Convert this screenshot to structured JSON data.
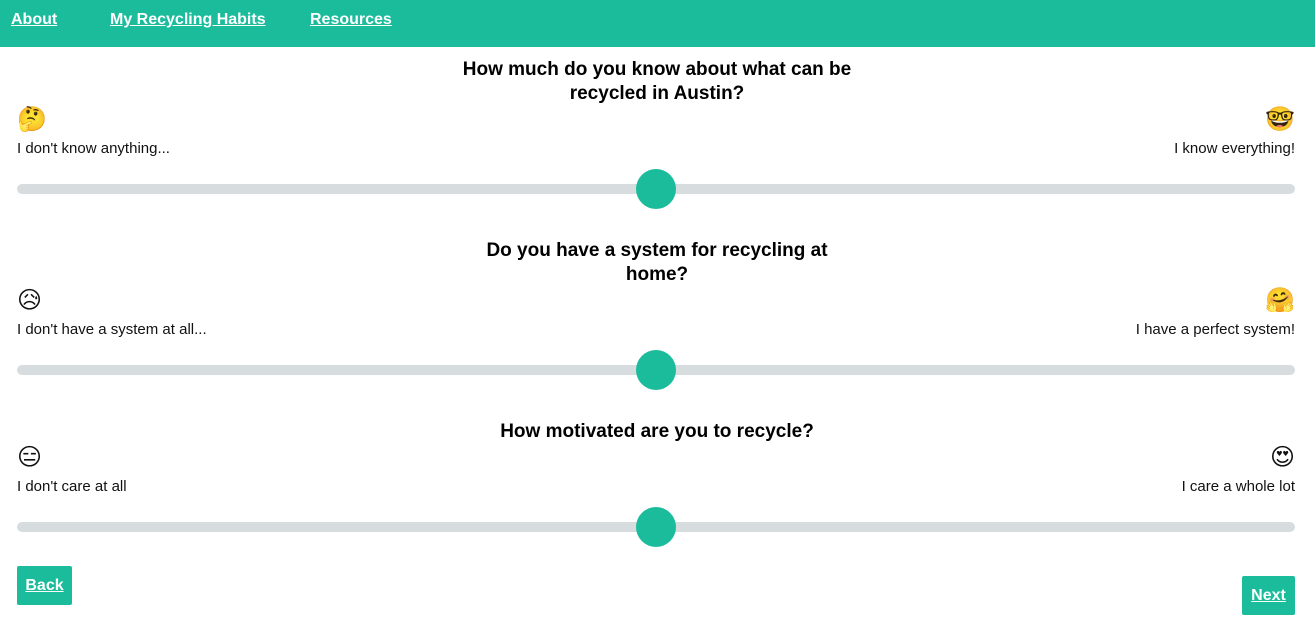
{
  "nav": {
    "about": "About",
    "habits": "My Recycling Habits",
    "resources": "Resources"
  },
  "questions": [
    {
      "title": "How much do you know about what can be recycled in Austin?",
      "left_emoji": "🤔",
      "right_emoji": "🤓",
      "left_label": "I don't know anything...",
      "right_label": "I know everything!",
      "value": 0.5
    },
    {
      "title": "Do you have a system for recycling at home?",
      "left_emoji": "😥",
      "right_emoji": "🤗",
      "left_label": "I don't have a system at all...",
      "right_label": "I have a perfect system!",
      "value": 0.5
    },
    {
      "title": "How motivated are you to recycle?",
      "left_emoji": "😑",
      "right_emoji": "😍",
      "left_label": "I don't care at all",
      "right_label": "I care a whole lot",
      "value": 0.5
    }
  ],
  "buttons": {
    "back": "Back",
    "next": "Next"
  },
  "colors": {
    "accent": "#1abc9c",
    "track": "#d7dcdf"
  }
}
